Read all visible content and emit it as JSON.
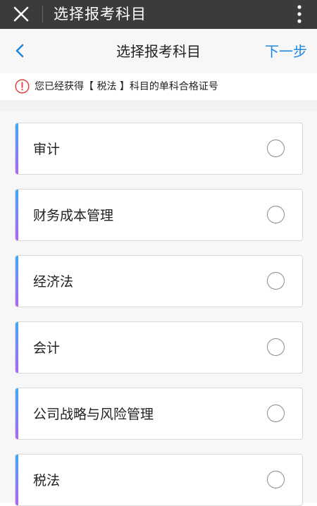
{
  "topbar": {
    "title": "选择报考科目",
    "close_icon": "close-icon",
    "more_icon": "more-vertical-icon"
  },
  "navbar": {
    "title": "选择报考科目",
    "next_label": "下一步",
    "back_icon": "chevron-left-icon"
  },
  "notice": {
    "text": "您已经获得【 税法 】科目的单科合格证号",
    "icon": "info-icon"
  },
  "subjects": [
    {
      "label": "审计",
      "selected": false
    },
    {
      "label": "财务成本管理",
      "selected": false
    },
    {
      "label": "经济法",
      "selected": false
    },
    {
      "label": "会计",
      "selected": false
    },
    {
      "label": "公司战略与风险管理",
      "selected": false
    },
    {
      "label": "税法",
      "selected": false
    }
  ],
  "colors": {
    "topbar_bg": "#3b3b3b",
    "accent_link": "#1e88e5",
    "notice_icon": "#e53935",
    "card_stripe_top": "#3fa9f5",
    "card_stripe_bottom": "#b066f0"
  }
}
